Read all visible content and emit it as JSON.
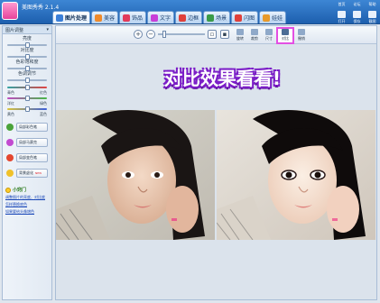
{
  "app": {
    "title": "美图秀秀 2.1.4",
    "logo_text": "美图秀秀"
  },
  "tabs": [
    {
      "label": "图片处理",
      "icon": "photo-icon",
      "color": "#3b7fd8"
    },
    {
      "label": "美容",
      "icon": "face-icon",
      "color": "#f08a2a"
    },
    {
      "label": "饰品",
      "icon": "heart-icon",
      "color": "#e33b5a"
    },
    {
      "label": "文字",
      "icon": "text-icon",
      "color": "#c83fd8"
    },
    {
      "label": "边框",
      "icon": "frame-icon",
      "color": "#e0403a"
    },
    {
      "label": "场景",
      "icon": "scene-icon",
      "color": "#3a9b48"
    },
    {
      "label": "闪图",
      "icon": "flash-icon",
      "color": "#e0403a"
    },
    {
      "label": "娃娃",
      "icon": "doll-icon",
      "color": "#e89a2a"
    }
  ],
  "topright": {
    "links": [
      "首页",
      "论坛",
      "帮助"
    ],
    "buttons": [
      "打开",
      "保存",
      "截图"
    ]
  },
  "left_panel": {
    "header": "图片调整",
    "sliders": [
      {
        "label": "亮度",
        "level": 0.5
      },
      {
        "label": "对比度",
        "level": 0.5
      },
      {
        "label": "色彩饱和度",
        "level": 0.5
      },
      {
        "label": "色调调节",
        "level": 0.5
      }
    ],
    "color_sliders": [
      {
        "left": "青色",
        "right": "红色",
        "level": 0.5
      },
      {
        "left": "洋红",
        "right": "绿色",
        "level": 0.5
      },
      {
        "left": "黄色",
        "right": "蓝色",
        "level": 0.5
      }
    ],
    "effects": [
      {
        "label": "局部彩色笔",
        "color": "#4aa33a"
      },
      {
        "label": "局部马赛克",
        "color": "#c24ad0"
      },
      {
        "label": "局部变色笔",
        "color": "#e4462f"
      },
      {
        "label": "背景虚化",
        "color": "#f0c12a",
        "badge": "NEW"
      }
    ],
    "tips_title": "小窍门",
    "tips": [
      "调整图片的亮度、对比度",
      "怎样替换底色",
      "如果要给头像增色"
    ]
  },
  "toolbar": {
    "zoom_level": 0.1,
    "buttons": [
      "旋转",
      "裁剪",
      "尺寸",
      "对比",
      "撤销"
    ]
  },
  "caption": "对比效果看看!"
}
